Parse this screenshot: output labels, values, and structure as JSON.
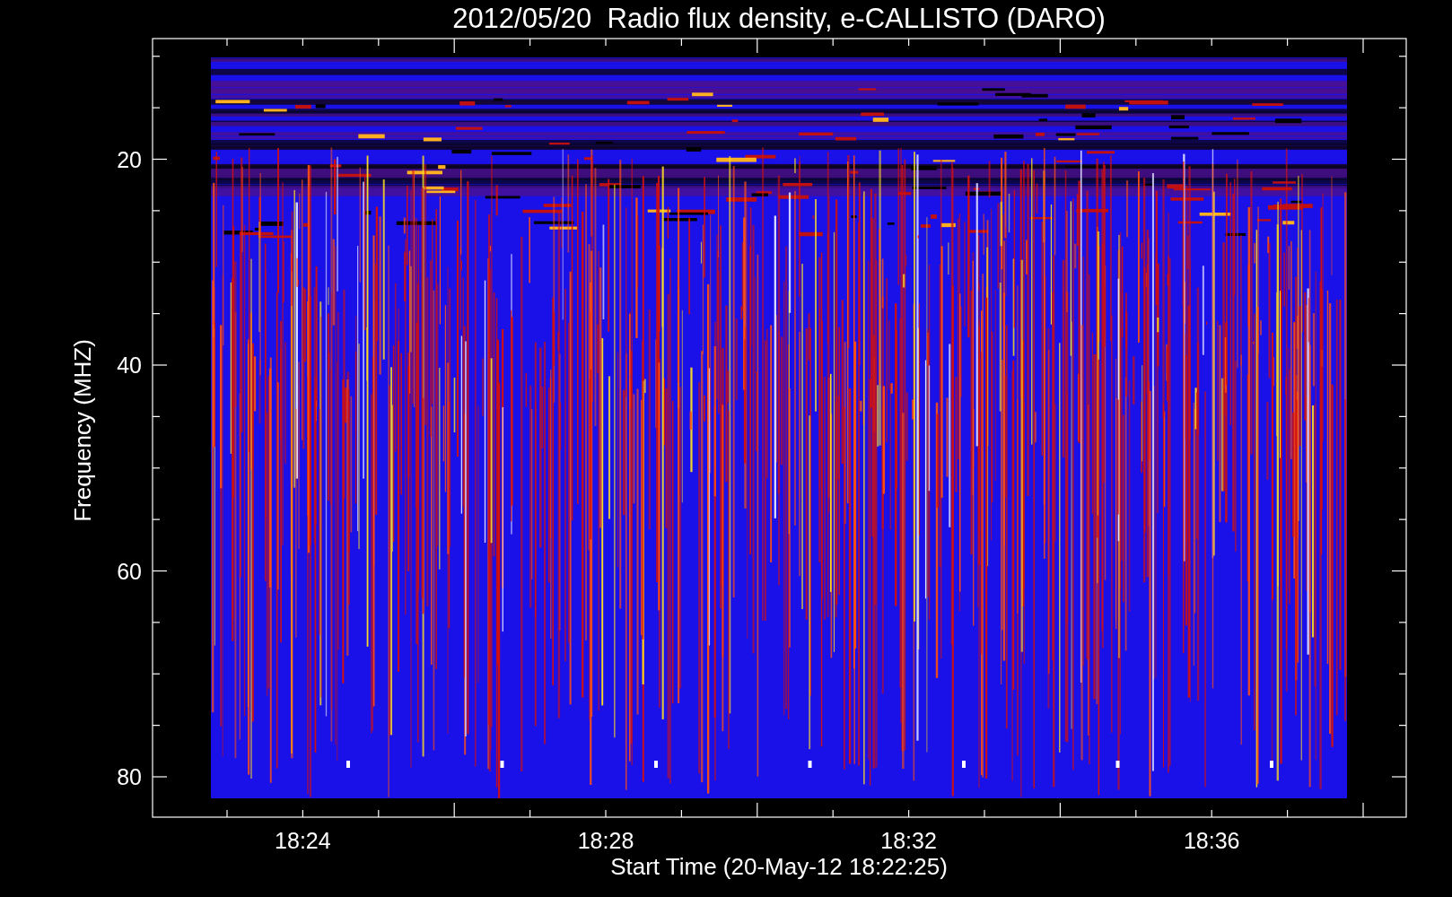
{
  "title": "2012/05/20  Radio flux density, e-CALLISTO (DARO)",
  "y_axis": {
    "label": "Frequency (MHZ)",
    "ticks": [
      "20",
      "40",
      "60",
      "80"
    ]
  },
  "x_axis": {
    "label": "Start Time (20-May-12 18:22:25)",
    "ticks": [
      "18:24",
      "18:28",
      "18:32",
      "18:36"
    ]
  }
}
